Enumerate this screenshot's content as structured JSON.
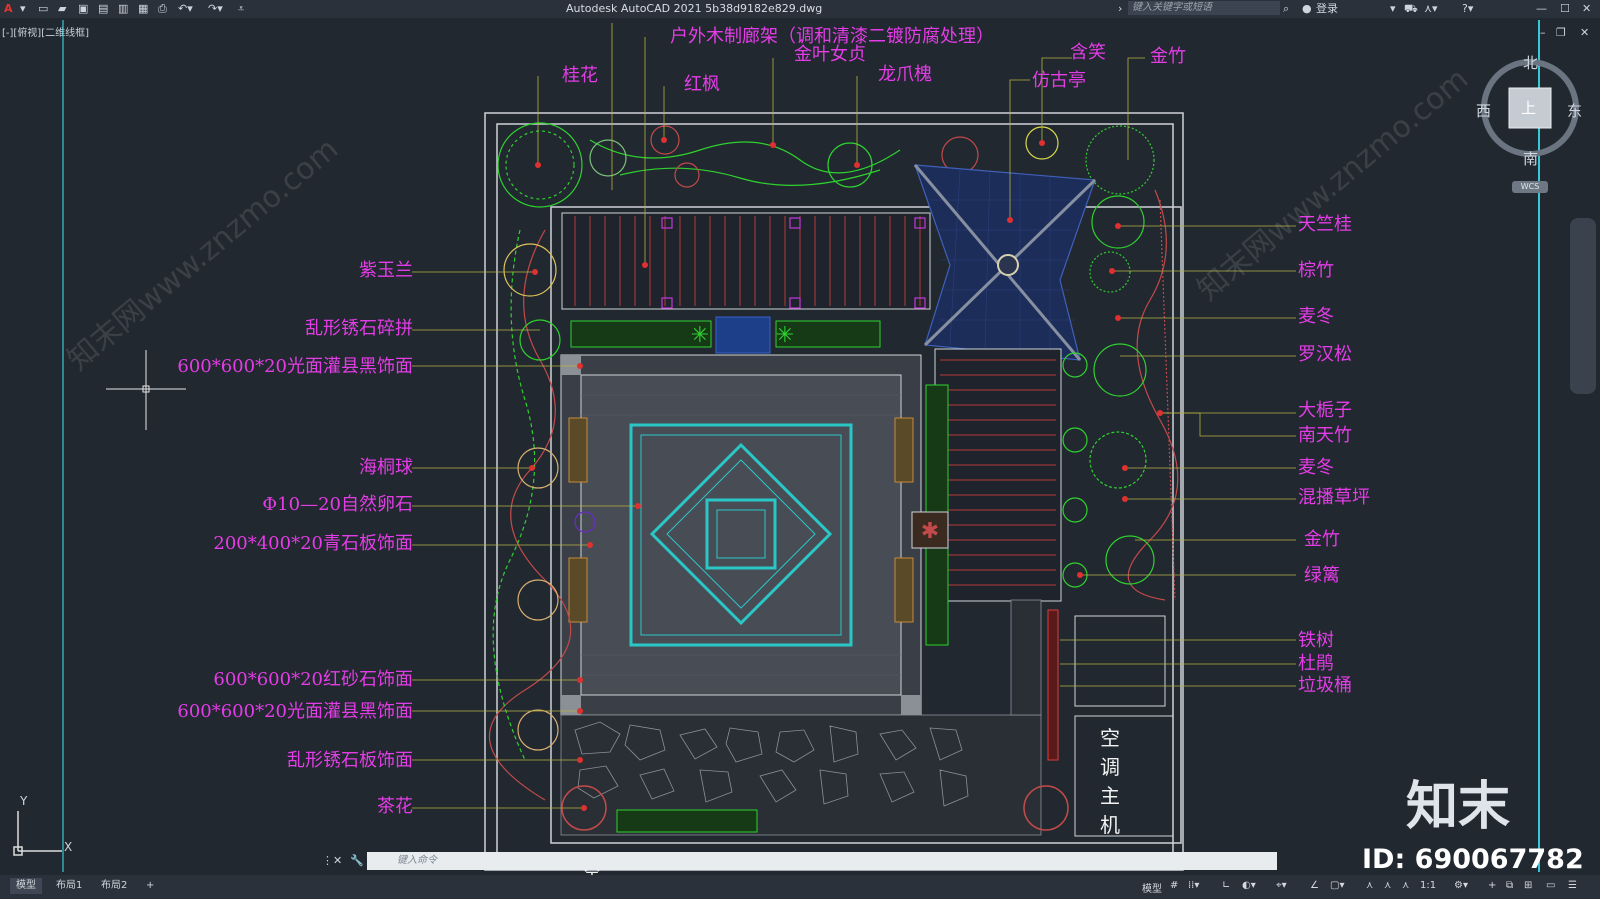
{
  "titlebar": {
    "app_title": "Autodesk AutoCAD 2021    5b38d9182e829.dwg",
    "search_placeholder": "键入关键字或短语",
    "login_label": "登录",
    "app_icon": "autocad-logo-icon"
  },
  "viewport": {
    "view_label": "[-][俯视][二维线框]"
  },
  "viewcube": {
    "north": "北",
    "south": "南",
    "east": "东",
    "west": "西",
    "top_face": "上",
    "wcs_label": "WCS"
  },
  "labels_top": {
    "corridor": "户外木制廊架（调和清漆二镀防腐处理）",
    "privet": "金叶女贞",
    "osmanthus": "桂花",
    "red_maple": "红枫",
    "pagoda": "龙爪槐",
    "michelia": "含笑",
    "pavilion": "仿古亭",
    "golden_bamboo": "金竹"
  },
  "labels_left": [
    "紫玉兰",
    "乱形锈石碎拼",
    "600*600*20光面灌县黑饰面",
    "海桐球",
    "Φ10—20自然卵石",
    "200*400*20青石板饰面",
    "600*600*20红砂石饰面",
    "600*600*20光面灌县黑饰面",
    "乱形锈石板饰面",
    "茶花"
  ],
  "labels_right": [
    "天竺桂",
    "棕竹",
    "麦冬",
    "罗汉松",
    "大栀子",
    "南天竹",
    "麦冬",
    "混播草坪",
    "金竹",
    "绿篱",
    "铁树",
    "杜鹃",
    "垃圾桶"
  ],
  "ac_unit": [
    "空",
    "调",
    "主",
    "机"
  ],
  "bottom_partial_text": "空",
  "command": {
    "placeholder": "键入命令"
  },
  "tabs": [
    "模型",
    "布局1",
    "布局2",
    "+"
  ],
  "status": {
    "model": "模型",
    "scale": "1:1"
  },
  "ucs": {
    "y_axis": "Y",
    "x_axis": "X"
  },
  "watermark": {
    "brand": "知末",
    "id_text": "ID: 690067782",
    "diagonal": "知末网www.znzmo.com"
  },
  "colors": {
    "label_magenta": "#e43ce6",
    "background": "#212830",
    "plant_green": "#2fd12f",
    "cyan_pattern": "#2bc7c7"
  }
}
